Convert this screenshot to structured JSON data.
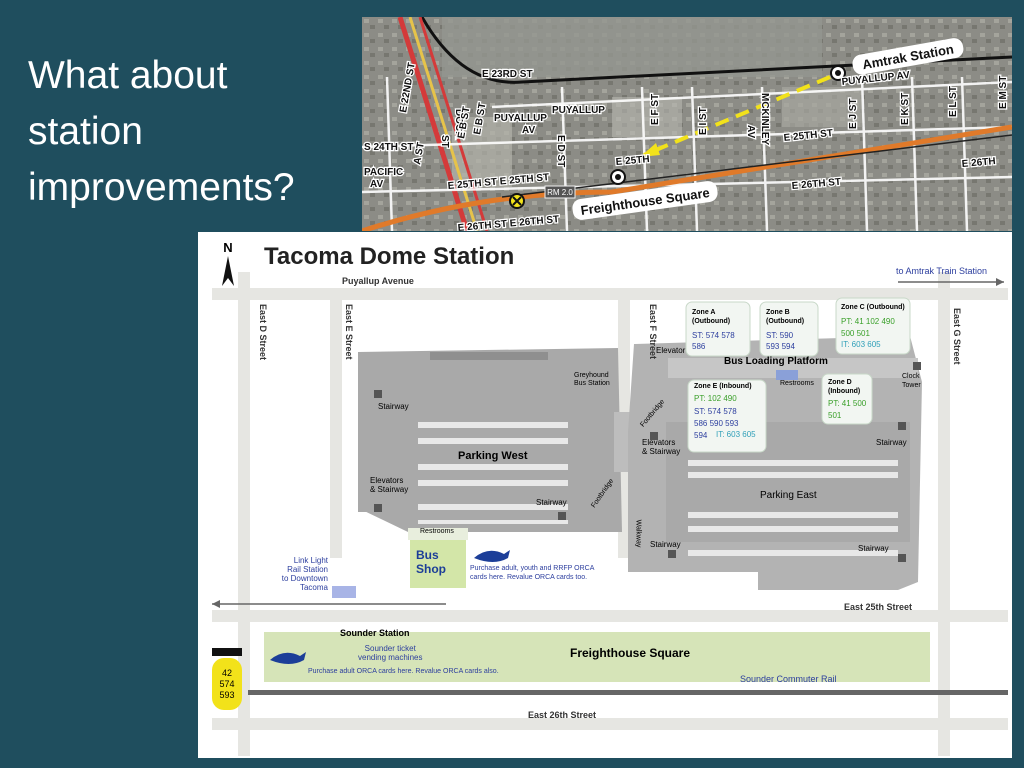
{
  "slide": {
    "title": "What about\nstation\nimprovements?"
  },
  "aerial": {
    "streets": {
      "e23rd": "E 23RD ST",
      "puyallup_av1": "PUYALLUP",
      "puyallup_av2": "PUYALLUP",
      "av": "AV",
      "puyallup_av_right": "PUYALLUP AV",
      "e22nd": "E 22ND ST",
      "dock": "DOCK",
      "dock_st": "ST",
      "e_b_st": "E B ST",
      "e_b_st2": "E B ST",
      "s24th": "S 24TH ST",
      "a_st": "A ST",
      "pacific": "PACIFIC",
      "pacific_av": "AV",
      "e_d_st": "E D ST",
      "e_f_st": "E F ST",
      "e_i_st": "E I ST",
      "mckinley": "MCKINLEY",
      "mckinley_av": "AV",
      "e25th_right": "E 25TH ST",
      "e_j_st": "E J ST",
      "e_k_st": "E K ST",
      "e_l_st": "E L ST",
      "e_m_st": "E M ST",
      "e25th_left": "E 25TH ST E 25TH ST",
      "e25th_mid": "E 25TH",
      "e26th_left": "E 26TH ST E 26TH ST",
      "e26th_right": "E 26TH ST",
      "e26th_far": "E 26TH",
      "rm": "RM 2.0"
    },
    "amtrak_label": "Amtrak Station",
    "freighthouse_label": "Freighthouse Square"
  },
  "station_map": {
    "title": "Tacoma Dome Station",
    "north": "N",
    "amtrak_link": "to Amtrak Train Station",
    "streets": {
      "puyallup_ave": "Puyallup Avenue",
      "east_d": "East D Street",
      "east_e": "East E Street",
      "east_f": "East F Street",
      "east_g": "East G Street",
      "east_25th": "East 25th Street",
      "east_26th": "East 26th Street"
    },
    "zones": {
      "a": {
        "title": "Zone A\n(Outbound)",
        "st": "ST: 574  578\n586"
      },
      "b": {
        "title": "Zone B\n(Outbound)",
        "st": "ST: 590\n593  594"
      },
      "c": {
        "title": "Zone C (Outbound)",
        "pt": "PT: 41 102 490\n500 501",
        "it": "IT: 603 605"
      },
      "d": {
        "title": "Zone D\n(Inbound)",
        "pt": "PT: 41  500\n501"
      },
      "e": {
        "title": "Zone E (Inbound)",
        "pt": "PT: 102 490",
        "st": "ST: 574  578\n586  590  593\n594",
        "it": "IT: 603 605"
      }
    },
    "labels": {
      "elevator": "Elevator",
      "bus_platform": "Bus Loading Platform",
      "restrooms_top": "Restrooms",
      "clock_tower": "Clock\nTower",
      "greyhound": "Greyhound\nBus Station",
      "footbridge1": "Footbridge",
      "footbridge2": "Footbridge",
      "stairway_nw": "Stairway",
      "parking_west": "Parking West",
      "elevators_stairway_w": "Elevators\n& Stairway",
      "stairway_w2": "Stairway",
      "elevators_stairway_c": "Elevators\n& Stairway",
      "stairway_ne": "Stairway",
      "parking_east": "Parking East",
      "walkway": "Walkway",
      "stairway_sw_e": "Stairway",
      "stairway_se": "Stairway",
      "restrooms_shop": "Restrooms",
      "bus_shop": "Bus\nShop",
      "orca_bus_shop": "Purchase adult, youth and RRFP ORCA\ncards here. Revalue ORCA cards too.",
      "link_light_rail": "Link Light\nRail Station\nto Downtown\nTacoma",
      "sounder_station": "Sounder Station",
      "ticket_machines": "Sounder ticket\nvending machines",
      "orca_sounder": "Purchase adult ORCA cards here. Revalue ORCA cards also.",
      "freighthouse_square": "Freighthouse Square",
      "sounder_rail": "Sounder Commuter Rail",
      "bus_routes": "42\n574\n593"
    }
  },
  "colors": {
    "background": "#1f4e5e",
    "st_blue": "#2c3e9e",
    "pt_green": "#3aa02a",
    "it_teal": "#2f9fb8"
  }
}
